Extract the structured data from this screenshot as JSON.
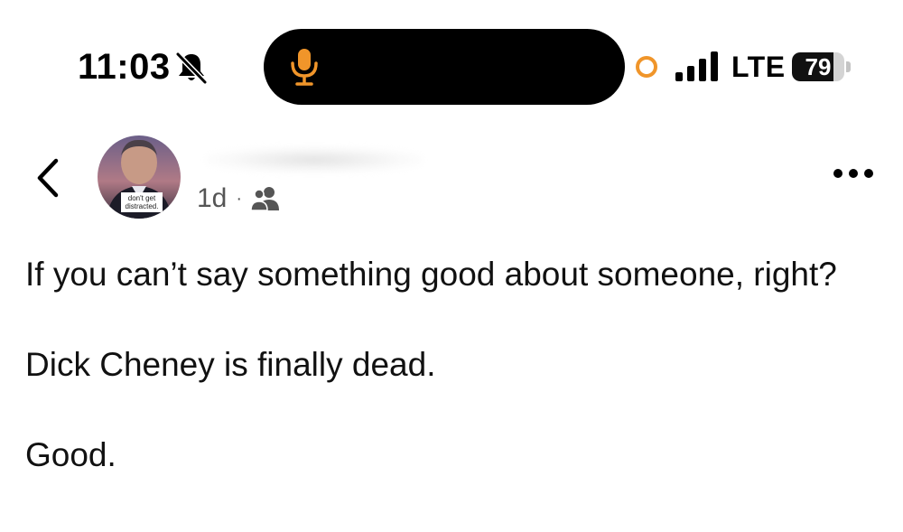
{
  "status_bar": {
    "time": "11:03",
    "network": "LTE",
    "battery": "79",
    "battery_level": 0.79,
    "mic_color": "#f0952a",
    "recording_color": "#f0952a",
    "icons": [
      "bell-slash-icon",
      "microphone-icon",
      "signal-icon",
      "battery-icon"
    ]
  },
  "post": {
    "avatar_caption": "don't get distracted.",
    "time_ago": "1d",
    "separator": "·",
    "audience_icon": "group-icon",
    "paragraphs": [
      "If you can’t say something good about someone, right?",
      "Dick Cheney is finally dead.",
      "Good."
    ]
  },
  "header": {
    "back_icon": "chevron-left-icon",
    "more_icon": "more-horizontal-icon"
  }
}
